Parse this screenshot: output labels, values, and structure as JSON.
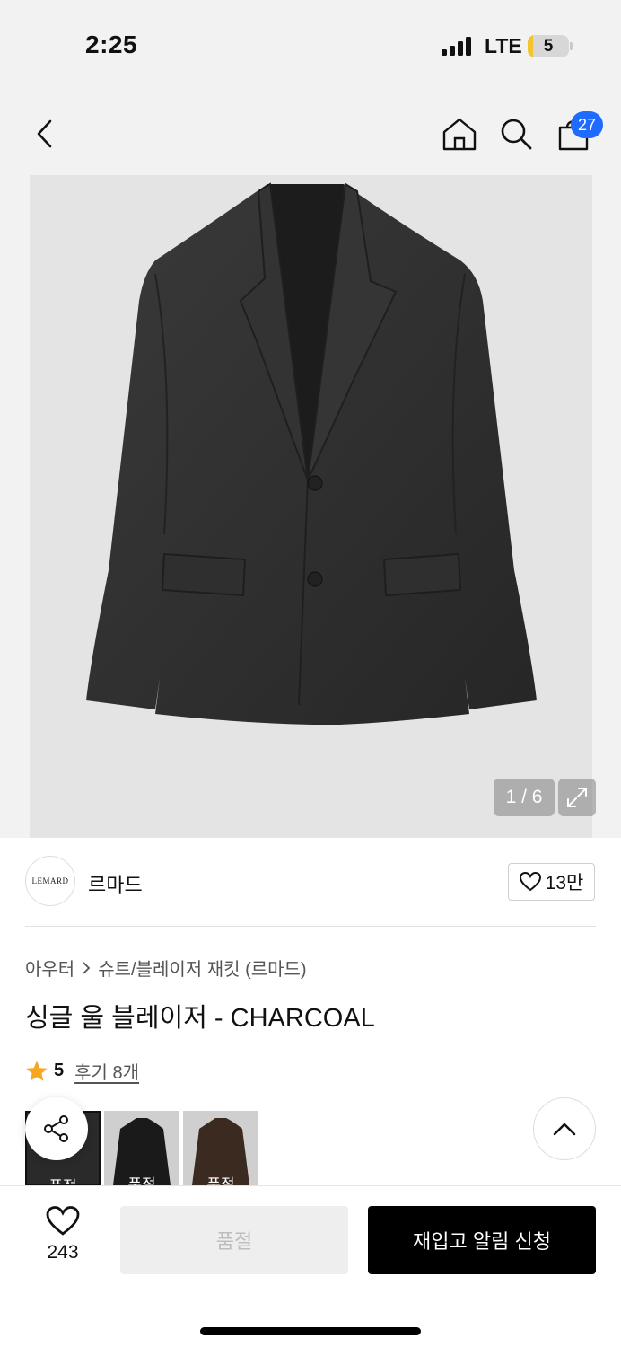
{
  "status_bar": {
    "time": "2:25",
    "network": "LTE",
    "battery": "5"
  },
  "nav": {
    "cart_count": "27",
    "icons": [
      "back-icon",
      "home-icon",
      "search-icon",
      "shopping-bag-icon"
    ]
  },
  "gallery": {
    "counter": "1 / 6"
  },
  "brand": {
    "logo_text": "LEMARD",
    "name": "르마드",
    "likes": "13만"
  },
  "breadcrumb": {
    "category": "아우터",
    "subcategory": "슈트/블레이저 재킷 (르마드)"
  },
  "product": {
    "title": "싱글 울 블레이저 - CHARCOAL",
    "rating": "5",
    "reviews": "후기 8개"
  },
  "variants": [
    {
      "label": "품절",
      "color": "#2a2a2a"
    },
    {
      "label": "품절",
      "color": "#1a1a1a"
    },
    {
      "label": "품절",
      "color": "#3b2a1f"
    }
  ],
  "bottom": {
    "wish_count": "243",
    "soldout_label": "품절",
    "restock_label": "재입고 알림 신청"
  },
  "colors": {
    "accent_blue": "#1f6bff",
    "star": "#f5a623",
    "primary_button": "#000000"
  }
}
